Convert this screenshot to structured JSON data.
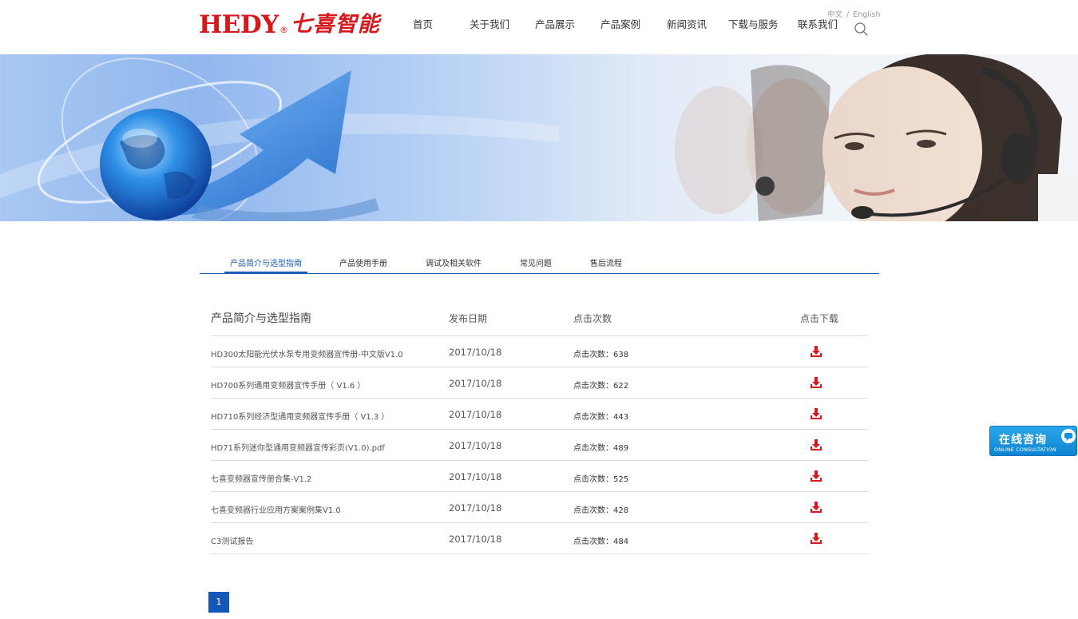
{
  "header": {
    "logo_text": "HEDY",
    "logo_reg": "®",
    "logo_cn": "七喜智能",
    "nav": [
      {
        "label": "首页"
      },
      {
        "label": "关于我们"
      },
      {
        "label": "产品展示"
      },
      {
        "label": "产品案例"
      },
      {
        "label": "新闻资讯"
      },
      {
        "label": "下载与服务"
      },
      {
        "label": "联系我们"
      }
    ],
    "lang": {
      "zh": "中文",
      "sep": "/",
      "en": "English"
    }
  },
  "tabs": {
    "active_index": 0,
    "items": [
      {
        "label": "产品简介与选型指南"
      },
      {
        "label": "产品使用手册"
      },
      {
        "label": "调试及相关软件"
      },
      {
        "label": "常见问题"
      },
      {
        "label": "售后流程"
      }
    ]
  },
  "table": {
    "headers": {
      "name": "产品简介与选型指南",
      "date": "发布日期",
      "clicks": "点击次数",
      "download": "点击下载"
    },
    "rows": [
      {
        "name": "HD300太阳能光伏水泵专用变频器宣传册-中文版V1.0",
        "date": "2017/10/18",
        "clicks": "点击次数：638"
      },
      {
        "name": "HD700系列通用变频器宣传手册（ V1.6 ）",
        "date": "2017/10/18",
        "clicks": "点击次数：622"
      },
      {
        "name": "HD710系列经济型通用变频器宣传手册（ V1.3 ）",
        "date": "2017/10/18",
        "clicks": "点击次数：443"
      },
      {
        "name": "HD71系列迷你型通用变频器宣传彩页(V1.0).pdf",
        "date": "2017/10/18",
        "clicks": "点击次数：489"
      },
      {
        "name": "七喜变频器宣传册合集-V1.2",
        "date": "2017/10/18",
        "clicks": "点击次数：525"
      },
      {
        "name": "七喜变频器行业应用方案案例集V1.0",
        "date": "2017/10/18",
        "clicks": "点击次数：428"
      },
      {
        "name": "C3测试报告",
        "date": "2017/10/18",
        "clicks": "点击次数：484"
      }
    ]
  },
  "pagination": {
    "current": "1"
  },
  "consult": {
    "title": "在线咨询",
    "subtitle": "ONLINE CONSULTATION"
  },
  "colors": {
    "brand_red": "#d7191e",
    "accent_blue": "#1d5db8",
    "download_red": "#d7191e"
  }
}
